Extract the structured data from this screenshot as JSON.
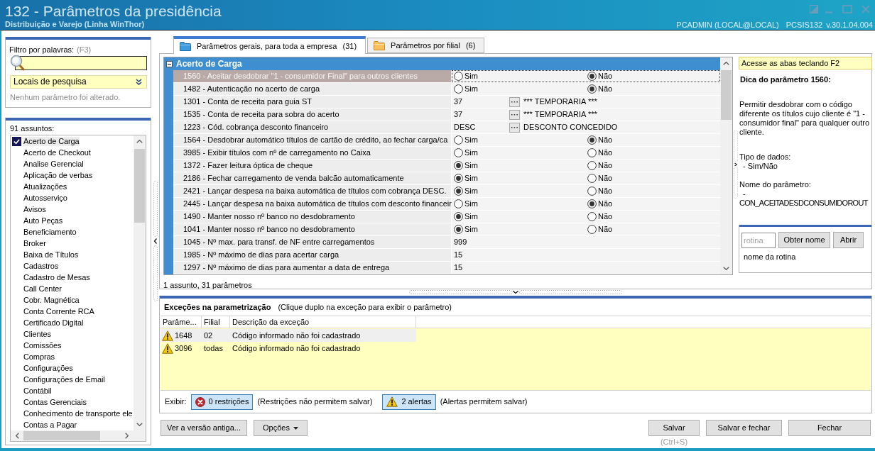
{
  "window": {
    "title": "132 - Parâmetros da presidência",
    "subtitle": "Distribuição e Varejo (Linha WinThor)",
    "user": "PCADMIN (LOCAL@LOCAL)",
    "program": "PCSIS132",
    "version": "v.30.1.04.004"
  },
  "filter": {
    "label": "Filtro por palavras:",
    "shortcut": "(F3)",
    "search_locations": "Locais de pesquisa",
    "status": "Nenhum parâmetro foi alterado."
  },
  "subjects": {
    "count": "91 assuntos:",
    "items": [
      {
        "label": "Acerto de Carga",
        "selected": true
      },
      {
        "label": "Acerto de Checkout",
        "selected": false
      },
      {
        "label": "Analise Gerencial",
        "selected": false
      },
      {
        "label": "Aplicação de verbas",
        "selected": false
      },
      {
        "label": "Atualizações",
        "selected": false
      },
      {
        "label": "Autosserviço",
        "selected": false
      },
      {
        "label": "Avisos",
        "selected": false
      },
      {
        "label": "Auto Peças",
        "selected": false
      },
      {
        "label": "Beneficiamento",
        "selected": false
      },
      {
        "label": "Broker",
        "selected": false
      },
      {
        "label": "Baixa de Títulos",
        "selected": false
      },
      {
        "label": "Cadastros",
        "selected": false
      },
      {
        "label": "Cadastro de Mesas",
        "selected": false
      },
      {
        "label": "Call Center",
        "selected": false
      },
      {
        "label": "Cobr. Magnética",
        "selected": false
      },
      {
        "label": "Conta Corrente RCA",
        "selected": false
      },
      {
        "label": "Certificado Digital",
        "selected": false
      },
      {
        "label": "Clientes",
        "selected": false
      },
      {
        "label": "Comissões",
        "selected": false
      },
      {
        "label": "Compras",
        "selected": false
      },
      {
        "label": "Configurações",
        "selected": false
      },
      {
        "label": "Configurações de Email",
        "selected": false
      },
      {
        "label": "Contábil",
        "selected": false
      },
      {
        "label": "Contas Gerenciais",
        "selected": false
      },
      {
        "label": "Conhecimento de transporte ele",
        "selected": false
      },
      {
        "label": "Contas a Pagar",
        "selected": false
      }
    ]
  },
  "tabs": [
    {
      "label": "Parâmetros gerais, para toda a empresa",
      "count": "(31)",
      "selected": true
    },
    {
      "label": "Parâmetros por filial",
      "count": "(6)",
      "selected": false
    }
  ],
  "grid": {
    "group": "Acerto de Carga",
    "rows": [
      {
        "label": "1560 - Aceitar desdobrar \"1 - consumidor Final\" para outros clientes",
        "kind": "boolean",
        "options": [
          {
            "label": "Sim",
            "selected": false
          },
          {
            "label": "Não",
            "selected": true
          }
        ],
        "selected": true
      },
      {
        "label": "1482 - Autenticação no acerto de carga",
        "kind": "boolean",
        "options": [
          {
            "label": "Sim",
            "selected": false
          },
          {
            "label": "Não",
            "selected": true
          }
        ],
        "selected": false
      },
      {
        "label": "1301 - Conta de receita para guia ST",
        "kind": "lookup",
        "value": "37",
        "description": "*** TEMPORARIA ***",
        "selected": false
      },
      {
        "label": "1535 - Conta de receita para sobra do acerto",
        "kind": "lookup",
        "value": "37",
        "description": "*** TEMPORARIA ***",
        "selected": false
      },
      {
        "label": "1223 - Cód. cobrança desconto financeiro",
        "kind": "lookup",
        "value": "DESC",
        "description": "DESCONTO CONCEDIDO",
        "selected": false
      },
      {
        "label": "1564 - Desdobrar automático títulos de cartão de crédito, ao fechar carga/ca",
        "kind": "boolean",
        "options": [
          {
            "label": "Sim",
            "selected": false
          },
          {
            "label": "Não",
            "selected": true
          }
        ],
        "selected": false
      },
      {
        "label": "3985 - Exibir títulos com nº de carregamento no Caixa",
        "kind": "boolean",
        "options": [
          {
            "label": "Sim",
            "selected": false
          },
          {
            "label": "Não",
            "selected": false
          }
        ],
        "selected": false
      },
      {
        "label": "1372 - Fazer leitura óptica de cheque",
        "kind": "boolean",
        "options": [
          {
            "label": "Sim",
            "selected": true
          },
          {
            "label": "Não",
            "selected": false
          }
        ],
        "selected": false
      },
      {
        "label": "2186 - Fechar carregamento de venda balcão automaticamente",
        "kind": "boolean",
        "options": [
          {
            "label": "Sim",
            "selected": true
          },
          {
            "label": "Não",
            "selected": false
          }
        ],
        "selected": false
      },
      {
        "label": "2421 - Lançar despesa na baixa automática de títulos com cobrança DESC.",
        "kind": "boolean",
        "options": [
          {
            "label": "Sim",
            "selected": true
          },
          {
            "label": "Não",
            "selected": false
          }
        ],
        "selected": false
      },
      {
        "label": "2445 - Lançar despesa na baixa automática de títulos com desconto financeir",
        "kind": "boolean",
        "options": [
          {
            "label": "Sim",
            "selected": false
          },
          {
            "label": "Não",
            "selected": true
          }
        ],
        "selected": false
      },
      {
        "label": "1490 - Manter nosso nº banco no desdobramento",
        "kind": "boolean",
        "options": [
          {
            "label": "Sim",
            "selected": true
          },
          {
            "label": "Não",
            "selected": false
          }
        ],
        "selected": false
      },
      {
        "label": "1041 - Manter nosso nº banco no desdobramento",
        "kind": "boolean",
        "options": [
          {
            "label": "Sim",
            "selected": true
          },
          {
            "label": "Não",
            "selected": false
          }
        ],
        "selected": false
      },
      {
        "label": "1045 - Nº max. para transf. de NF entre carregamentos",
        "kind": "text",
        "value": "999",
        "selected": false
      },
      {
        "label": "1985 - Nº máximo de dias para acertar carga",
        "kind": "text",
        "value": "15",
        "selected": false
      },
      {
        "label": "1297 - Nº máximo de dias para aumentar a data de entrega",
        "kind": "text",
        "value": "15",
        "selected": false
      }
    ]
  },
  "summary": "1 assunto, 31 parâmetros",
  "tip": {
    "hint": "Acesse as abas teclando F2",
    "title": "Dica do parâmetro 1560:",
    "description": "Permitir desdobrar com o código diferente os títulos cujo cliente é \"1 - consumidor final\" para qualquer outro cliente.",
    "data_type_label": "Tipo de dados:",
    "data_type": "- Sim/Não",
    "name_label": "Nome do parâmetro:",
    "name_prefix": "-",
    "name": "CON_ACEITADESDCONSUMIDOROUT"
  },
  "routine": {
    "placeholder": "rotina",
    "buttons": [
      "Obter nome",
      "Abrir"
    ],
    "result": "nome da rotina"
  },
  "exceptions": {
    "title": "Exceções na parametrização",
    "hint": "(Clique duplo na exceção para exibir o parâmetro)",
    "columns": [
      "Parâme...",
      "Filial",
      "Descrição da exceção"
    ],
    "rows": [
      {
        "kind": "warning",
        "parameter": "1648",
        "branch": "02",
        "description": "Código informado não foi cadastrado",
        "selected": true
      },
      {
        "kind": "warning",
        "parameter": "3096",
        "branch": "todas",
        "description": "Código informado não foi cadastrado",
        "selected": false
      }
    ]
  },
  "display_filter": {
    "label": "Exibir:",
    "toggles": [
      {
        "kind": "error",
        "label": "0 restrições",
        "note": "(Restrições não permitem salvar)",
        "on": true
      },
      {
        "kind": "warning",
        "label": "2 alertas",
        "note": "(Alertas permitem salvar)",
        "on": true
      }
    ]
  },
  "actions": {
    "old_version": "Ver a versão antiga...",
    "options": "Opções",
    "save": "Salvar",
    "save_shortcut": "(Ctrl+S)",
    "save_and_close": "Salvar e fechar",
    "close": "Fechar"
  }
}
